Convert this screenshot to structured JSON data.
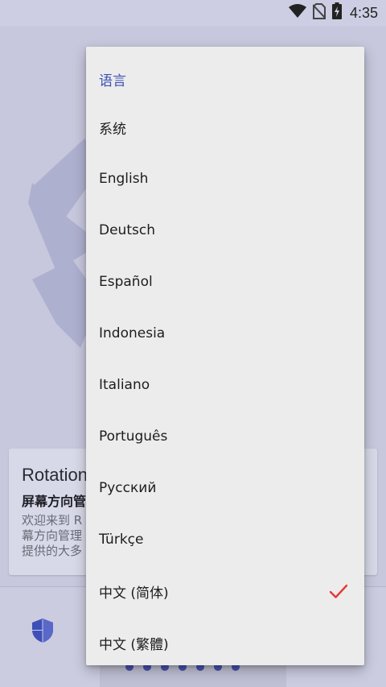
{
  "status_bar": {
    "time": "4:35",
    "icons": [
      "wifi-icon",
      "no-sim-icon",
      "battery-charging-icon"
    ]
  },
  "background": {
    "card": {
      "title": "Rotation",
      "subtitle": "屏幕方向管",
      "body_lines": [
        "欢迎来到 R",
        "幕方向管理",
        "提供的大多"
      ]
    },
    "bottom_bar": {
      "shield_icon": "shield-icon",
      "pager_dots": 7
    }
  },
  "language_menu": {
    "header": "语言",
    "items": [
      {
        "label": "系统",
        "selected": false
      },
      {
        "label": "English",
        "selected": false
      },
      {
        "label": "Deutsch",
        "selected": false
      },
      {
        "label": "Español",
        "selected": false
      },
      {
        "label": "Indonesia",
        "selected": false
      },
      {
        "label": "Italiano",
        "selected": false
      },
      {
        "label": "Português",
        "selected": false
      },
      {
        "label": "Русский",
        "selected": false
      },
      {
        "label": "Türkçe",
        "selected": false
      },
      {
        "label": "中文 (简体)",
        "selected": true
      },
      {
        "label": "中文 (繁體)",
        "selected": false
      }
    ],
    "selected_icon": "checkmark-icon"
  },
  "colors": {
    "accent": "#3f51b5",
    "check": "#e53935",
    "menu_bg": "#ececec",
    "scrim": "#c5c6dd"
  }
}
